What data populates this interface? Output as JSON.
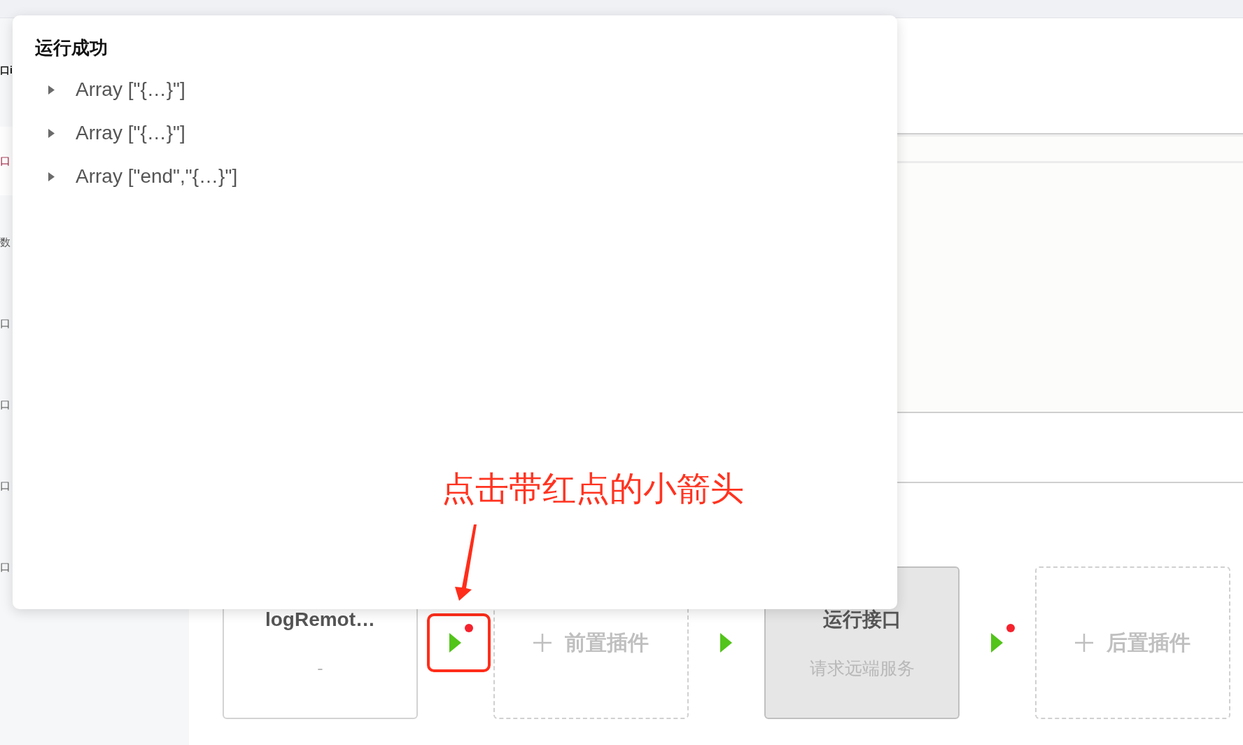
{
  "sidebar": {
    "header": "口i",
    "items": [
      {
        "label": "口",
        "selected": true
      },
      {
        "label": "数",
        "selected": false
      },
      {
        "label": "口",
        "selected": false
      },
      {
        "label": "口",
        "selected": false
      },
      {
        "label": "口",
        "selected": false
      },
      {
        "label": "口",
        "selected": false
      }
    ]
  },
  "popover": {
    "title": "运行成功",
    "nodes": [
      {
        "label": "Array [\"{…}\"]",
        "expanded": false
      },
      {
        "label": "Array [\"{…}\"]",
        "expanded": false
      },
      {
        "label": "Array [\"end\",\"{…}\"]",
        "expanded": false
      }
    ]
  },
  "annotation": {
    "text": "点击带红点的小箭头"
  },
  "flow": {
    "steps": [
      {
        "kind": "plugin",
        "title": "logRemot…",
        "subtitle": "-"
      },
      {
        "kind": "add",
        "label": "前置插件"
      },
      {
        "kind": "core",
        "title": "运行接口",
        "subtitle": "请求远端服务"
      },
      {
        "kind": "add",
        "label": "后置插件"
      }
    ],
    "connectors": [
      {
        "dot": true,
        "highlighted": true
      },
      {
        "dot": false,
        "highlighted": false
      },
      {
        "dot": true,
        "highlighted": false
      }
    ]
  }
}
